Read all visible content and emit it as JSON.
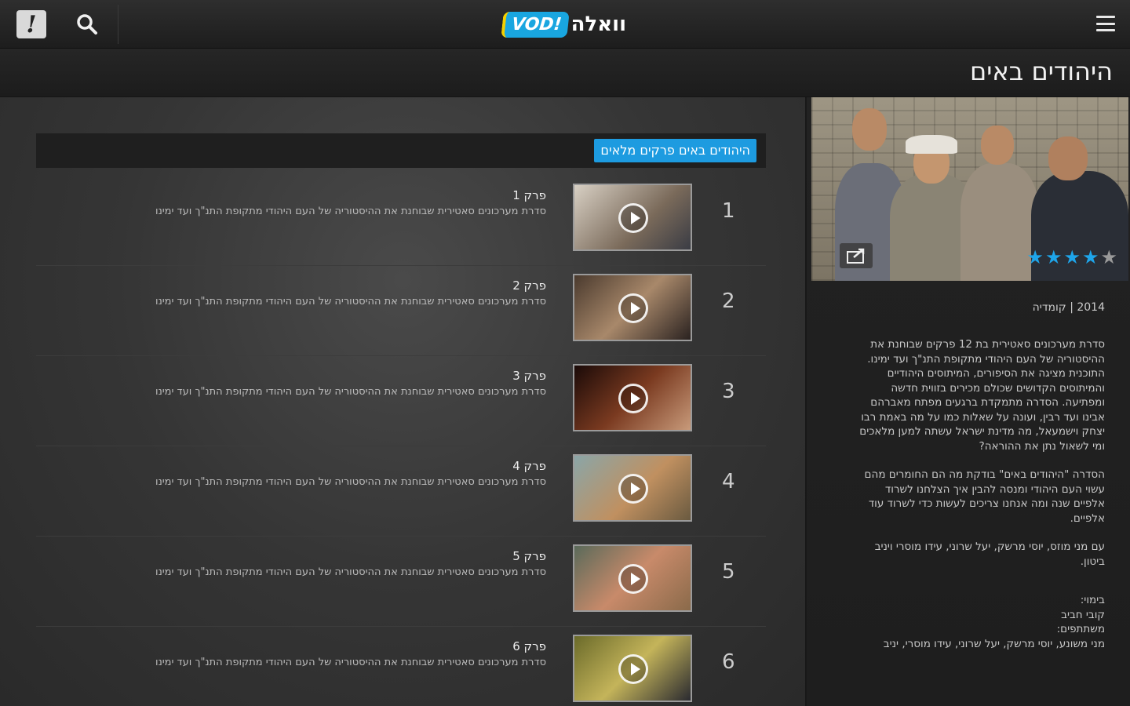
{
  "header": {
    "logo_badge": "VOD!",
    "logo_text": "וואלה"
  },
  "show": {
    "title": "היהודים באים",
    "rating": 3.5,
    "max_rating": 5,
    "meta": "2014 | קומדיה",
    "description_paragraphs": [
      [
        "סדרת מערכונים סאטירית בת 12 פרקים שבוחנת את",
        "ההיסטוריה של העם היהודי מתקופת התנ\"ך ועד ימינו.",
        "התוכנית מציגה את הסיפורים, המיתוסים היהודיים",
        "והמיתוסים הקדושים שכולם מכירים בזווית חדשה",
        "ומפתיעה. הסדרה מתמקדת ברגעים מפתח מאברהם",
        "אבינו ועד רבין, ועונה על שאלות כמו על מה באמת רבו",
        "יצחק וישמעאל, מה מדינת ישראל עשתה למען מלאכים",
        "ומי לשאול נתן את ההוראה?"
      ],
      [
        "הסדרה \"היהודים באים\" בודקת מה הם החומרים מהם",
        "עשוי העם היהודי ומנסה להבין איך הצלחנו לשרוד",
        "אלפיים שנה ומה אנחנו צריכים לעשות כדי לשרוד עוד",
        "אלפיים."
      ],
      [
        "עם מני מוזס, יוסי מרשק, יעל שרוני, עידו מוסרי ויניב",
        "ביטון."
      ],
      [
        "בימוי:",
        "קובי חביב",
        "משתתפים:",
        "מני משונע, יוסי מרשק, יעל שרוני, עידו מוסרי, יניב"
      ]
    ]
  },
  "episodes": {
    "header_button": "היהודים באים פרקים מלאים",
    "items": [
      {
        "number": "1",
        "title": "פרק 1",
        "desc": "סדרת מערכונים סאטירית שבוחנת את ההיסטוריה של העם היהודי מתקופת התנ\"ך ועד ימינו"
      },
      {
        "number": "2",
        "title": "פרק 2",
        "desc": "סדרת מערכונים סאטירית שבוחנת את ההיסטוריה של העם היהודי מתקופת התנ\"ך ועד ימינו"
      },
      {
        "number": "3",
        "title": "פרק 3",
        "desc": "סדרת מערכונים סאטירית שבוחנת את ההיסטוריה של העם היהודי מתקופת התנ\"ך ועד ימינו"
      },
      {
        "number": "4",
        "title": "פרק 4",
        "desc": "סדרת מערכונים סאטירית שבוחנת את ההיסטוריה של העם היהודי מתקופת התנ\"ך ועד ימינו"
      },
      {
        "number": "5",
        "title": "פרק 5",
        "desc": "סדרת מערכונים סאטירית שבוחנת את ההיסטוריה של העם היהודי מתקופת התנ\"ך ועד ימינו"
      },
      {
        "number": "6",
        "title": "פרק 6",
        "desc": "סדרת מערכונים סאטירית שבוחנת את ההיסטוריה של העם היהודי מתקופת התנ\"ך ועד ימינו"
      }
    ]
  },
  "icons": {
    "alert": "exclamation-icon",
    "search": "search-icon",
    "menu": "hamburger-menu-icon",
    "share": "share-icon",
    "play": "play-icon"
  },
  "colors": {
    "accent": "#1d9be0",
    "star": "#1ea5ea",
    "logo_yellow": "#f4d000"
  }
}
